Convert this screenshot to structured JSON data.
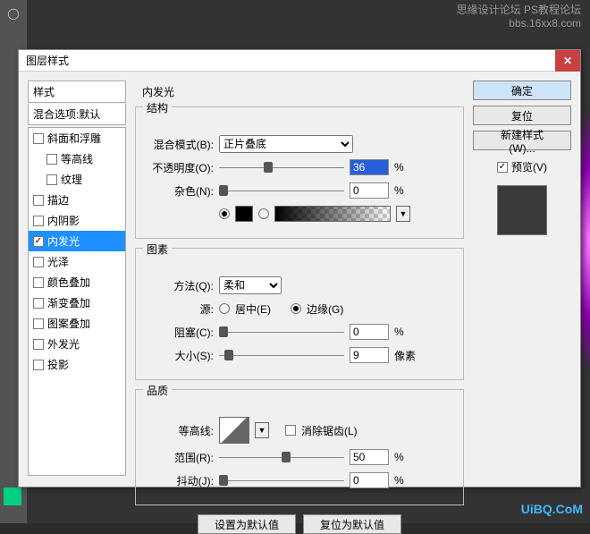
{
  "watermark": {
    "top1": "思缘设计论坛  PS教程论坛",
    "top2": "bbs.16xx8.com",
    "bottom": "UiBQ.CoM"
  },
  "dialog": {
    "title": "图层样式",
    "styles_header": "样式",
    "blend_opts": "混合选项:默认",
    "items": [
      {
        "label": "斜面和浮雕",
        "checked": false
      },
      {
        "label": "等高线",
        "checked": false,
        "child": true
      },
      {
        "label": "纹理",
        "checked": false,
        "child": true
      },
      {
        "label": "描边",
        "checked": false
      },
      {
        "label": "内阴影",
        "checked": false
      },
      {
        "label": "内发光",
        "checked": true,
        "selected": true
      },
      {
        "label": "光泽",
        "checked": false
      },
      {
        "label": "颜色叠加",
        "checked": false
      },
      {
        "label": "渐变叠加",
        "checked": false
      },
      {
        "label": "图案叠加",
        "checked": false
      },
      {
        "label": "外发光",
        "checked": false
      },
      {
        "label": "投影",
        "checked": false
      }
    ],
    "panel_name": "内发光",
    "structure": {
      "legend": "结构",
      "blend_mode_lbl": "混合模式(B):",
      "blend_mode_val": "正片叠底",
      "opacity_lbl": "不透明度(O):",
      "opacity_val": "36",
      "opacity_unit": "%",
      "noise_lbl": "杂色(N):",
      "noise_val": "0",
      "noise_unit": "%",
      "color": "#000000"
    },
    "elements": {
      "legend": "图素",
      "technique_lbl": "方法(Q):",
      "technique_val": "柔和",
      "source_lbl": "源:",
      "center_lbl": "居中(E)",
      "edge_lbl": "边缘(G)",
      "choke_lbl": "阻塞(C):",
      "choke_val": "0",
      "choke_unit": "%",
      "size_lbl": "大小(S):",
      "size_val": "9",
      "size_unit": "像素"
    },
    "quality": {
      "legend": "品质",
      "contour_lbl": "等高线:",
      "antialias_lbl": "消除锯齿(L)",
      "range_lbl": "范围(R):",
      "range_val": "50",
      "range_unit": "%",
      "jitter_lbl": "抖动(J):",
      "jitter_val": "0",
      "jitter_unit": "%"
    },
    "footer": {
      "default": "设置为默认值",
      "reset": "复位为默认值"
    },
    "right": {
      "ok": "确定",
      "cancel": "复位",
      "new": "新建样式(W)...",
      "preview": "预览(V)"
    }
  }
}
